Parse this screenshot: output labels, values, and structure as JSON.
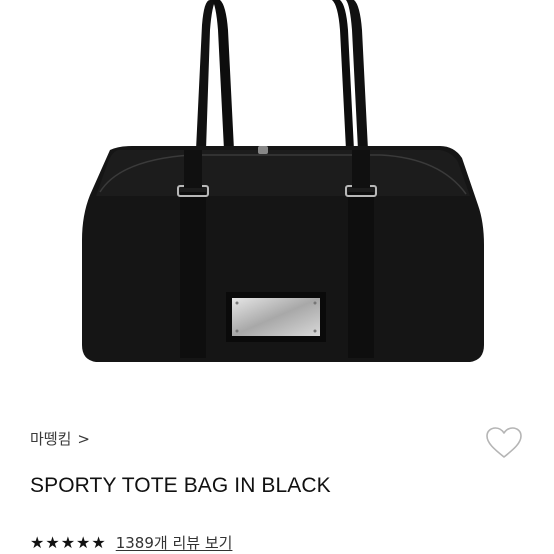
{
  "product": {
    "brand": "마뗑킴",
    "brand_chevron": ">",
    "title": "SPORTY TOTE BAG IN BLACK",
    "rating_stars": 5,
    "review_link": "1389개 리뷰 보기"
  },
  "icons": {
    "brand_chevron": "chevron-right-icon",
    "wishlist": "heart-outline-icon",
    "star": "star-filled-icon"
  },
  "colors": {
    "text_primary": "#111111",
    "text_secondary": "#3a3a3a",
    "bag": "#151515",
    "heart_outline": "#b5b5b5"
  }
}
